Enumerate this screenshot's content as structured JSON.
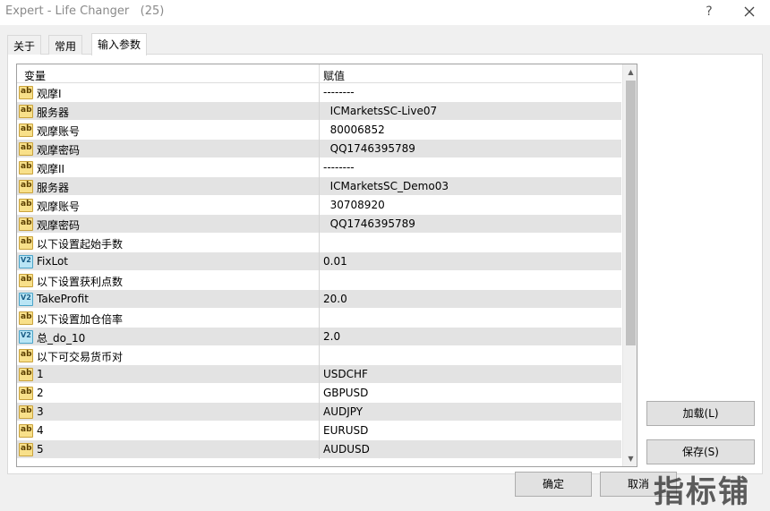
{
  "window": {
    "title": "Expert - Life Changer   (25)",
    "help_label": "?",
    "close_icon": "close-icon"
  },
  "tabs": [
    {
      "label": "关于",
      "active": false
    },
    {
      "label": "常用",
      "active": false
    },
    {
      "label": "输入参数",
      "active": true
    }
  ],
  "grid": {
    "header": {
      "variable": "变量",
      "value": "赋值"
    },
    "rows": [
      {
        "icon": "ab",
        "name": "观摩I",
        "value": "--------"
      },
      {
        "icon": "ab",
        "name": "服务器",
        "value": "  ICMarketsSC-Live07"
      },
      {
        "icon": "ab",
        "name": "观摩账号",
        "value": "  80006852"
      },
      {
        "icon": "ab",
        "name": "观摩密码",
        "value": "  QQ1746395789"
      },
      {
        "icon": "ab",
        "name": "观摩II",
        "value": "--------"
      },
      {
        "icon": "ab",
        "name": "服务器",
        "value": "  ICMarketsSC_Demo03"
      },
      {
        "icon": "ab",
        "name": "观摩账号",
        "value": "  30708920"
      },
      {
        "icon": "ab",
        "name": "观摩密码",
        "value": "  QQ1746395789"
      },
      {
        "icon": "ab",
        "name": "以下设置起始手数",
        "value": ""
      },
      {
        "icon": "v2",
        "name": "FixLot",
        "value": "0.01"
      },
      {
        "icon": "ab",
        "name": "以下设置获利点数",
        "value": ""
      },
      {
        "icon": "v2",
        "name": "TakeProfit",
        "value": "20.0"
      },
      {
        "icon": "ab",
        "name": "以下设置加仓倍率",
        "value": ""
      },
      {
        "icon": "v2",
        "name": "总_do_10",
        "value": "2.0"
      },
      {
        "icon": "ab",
        "name": "以下可交易货币对",
        "value": ""
      },
      {
        "icon": "ab",
        "name": "1",
        "value": "USDCHF"
      },
      {
        "icon": "ab",
        "name": "2",
        "value": "GBPUSD"
      },
      {
        "icon": "ab",
        "name": "3",
        "value": "AUDJPY"
      },
      {
        "icon": "ab",
        "name": "4",
        "value": "EURUSD"
      },
      {
        "icon": "ab",
        "name": "5",
        "value": "AUDUSD"
      }
    ]
  },
  "buttons": {
    "load": "加载(L)",
    "save": "保存(S)",
    "ok": "确定",
    "cancel": "取消"
  },
  "watermark": "指标铺"
}
